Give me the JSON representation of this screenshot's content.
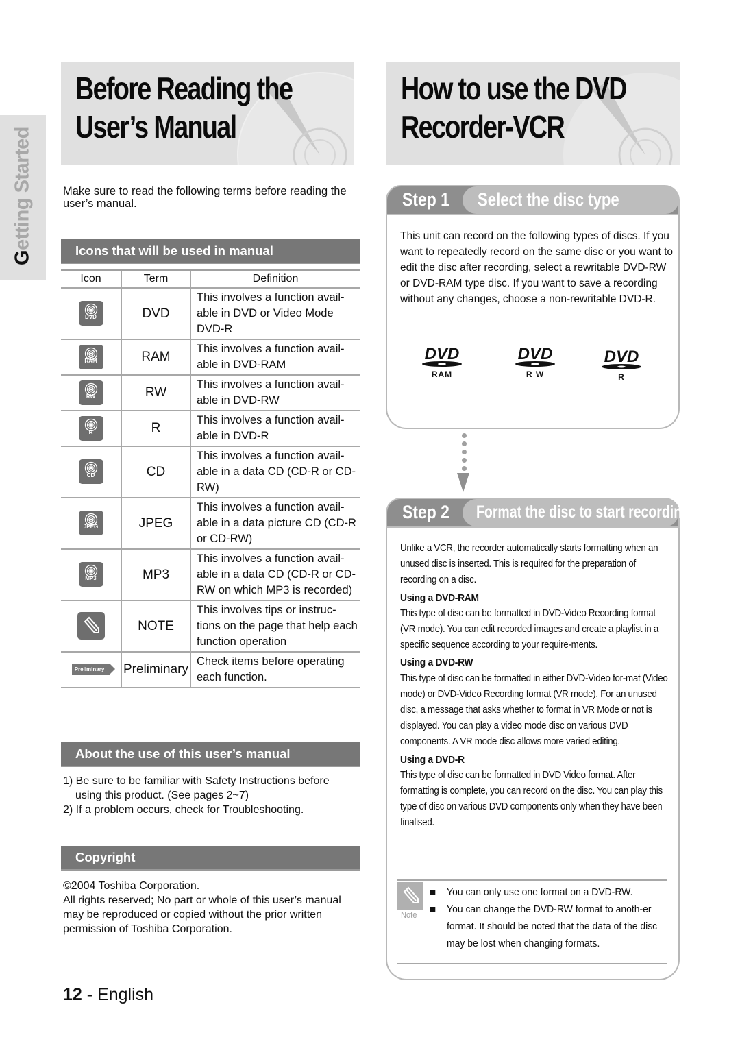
{
  "side_tab": {
    "label_first": "G",
    "label_rest": "etting Started"
  },
  "left": {
    "banner_title_line1": "Before Reading the",
    "banner_title_line2": "User’s Manual",
    "intro": "Make sure to read the following terms before reading the user’s manual.",
    "icons_section": {
      "heading": "Icons that will be used in manual",
      "columns": [
        "Icon",
        "Term",
        "Definition"
      ],
      "rows": [
        {
          "icon": "dvd-disc-icon",
          "icon_label": "DVD",
          "term": "DVD",
          "definition": "This involves a function avail-able in DVD or Video Mode DVD-R"
        },
        {
          "icon": "ram-disc-icon",
          "icon_label": "RAM",
          "term": "RAM",
          "definition": "This involves a function avail-able in DVD-RAM"
        },
        {
          "icon": "rw-disc-icon",
          "icon_label": "RW",
          "term": "RW",
          "definition": "This involves a function avail-able in DVD-RW"
        },
        {
          "icon": "r-disc-icon",
          "icon_label": "R",
          "term": "R",
          "definition": "This involves a function avail-able in DVD-R"
        },
        {
          "icon": "cd-disc-icon",
          "icon_label": "CD",
          "term": "CD",
          "definition": "This involves a function avail-able in a data CD (CD-R or CD-RW)"
        },
        {
          "icon": "jpeg-disc-icon",
          "icon_label": "JPEG",
          "term": "JPEG",
          "definition": "This involves a function avail-able in a data picture CD (CD-R or CD-RW)"
        },
        {
          "icon": "mp3-disc-icon",
          "icon_label": "MP3",
          "term": "MP3",
          "definition": "This involves a function avail-able in a data CD (CD-R or CD-RW on which MP3 is recorded)"
        },
        {
          "icon": "pencil-note-icon",
          "icon_label": "",
          "term": "NOTE",
          "definition": "This involves tips or instruc-tions on the page that help each function operation"
        },
        {
          "icon": "preliminary-arrow-icon",
          "icon_label": "Preliminary",
          "term": "Preliminary",
          "definition": "Check items before operating each function."
        }
      ]
    },
    "about_section": {
      "heading": "About the use of this user’s manual",
      "items": [
        "1) Be sure to be familiar with Safety Instructions before using this product. (See pages 2~7)",
        "2) If a problem occurs, check for Troubleshooting."
      ]
    },
    "copyright_section": {
      "heading": "Copyright",
      "line1": "©2004 Toshiba Corporation.",
      "body": "All rights reserved; No part or whole of this user’s manual may be reproduced or copied without the prior written permission of Toshiba Corporation."
    },
    "page_number": "12",
    "page_language": " - English"
  },
  "right": {
    "banner_title_line1": "How to use the DVD",
    "banner_title_line2": "Recorder-VCR",
    "step1": {
      "step_label": "Step 1",
      "title": "Select the disc type",
      "text": "This unit can record on the following types of discs. If you want to repeatedly record on the same disc or you want to edit the disc after recording, select a rewritable DVD-RW or DVD-RAM type disc. If you want to save a recording without any changes, choose a non-rewritable DVD-R.",
      "logos": [
        {
          "brand": "DVD",
          "format": "RAM"
        },
        {
          "brand": "DVD",
          "format": "R W"
        },
        {
          "brand": "DVD",
          "format": "R"
        }
      ]
    },
    "step2": {
      "step_label": "Step 2",
      "title": "Format the disc to start recording",
      "intro": "Unlike a VCR, the recorder automatically starts formatting when an unused disc is inserted. This is required for the preparation of recording on a disc.",
      "subsections": [
        {
          "heading": "Using a DVD-RAM",
          "text": "This type of disc can be formatted in DVD-Video Recording format (VR mode). You can edit recorded images and create a playlist in a specific sequence according to your require-ments."
        },
        {
          "heading": "Using a DVD-RW",
          "text": "This type of disc can be formatted in either DVD-Video for-mat (Video mode) or DVD-Video Recording format (VR mode). For an unused disc, a message that asks whether to format in VR Mode or not is displayed. You can play a video mode disc on various DVD components. A VR mode disc allows more varied editing."
        },
        {
          "heading": "Using a DVD-R",
          "text": "This type of disc can be formatted in DVD Video format. After formatting is complete, you can record on the disc. You can play this type of disc on various DVD components only when they have been finalised."
        }
      ],
      "note": {
        "label": "Note",
        "items": [
          "You can only use one format on a DVD-RW.",
          "You can change the DVD-RW format to anoth-er format. It should be noted that the data of the disc may be lost when changing formats."
        ]
      }
    }
  }
}
